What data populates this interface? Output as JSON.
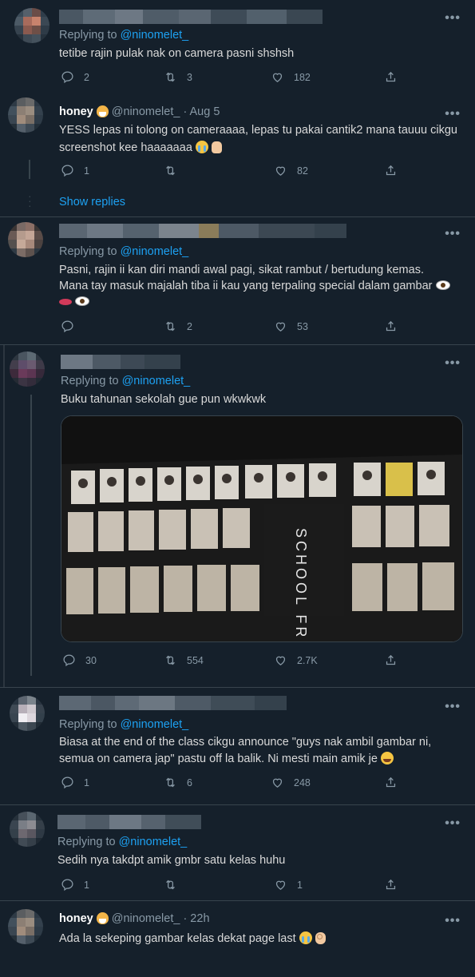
{
  "colors": {
    "background": "#15202b",
    "divider": "#38444d",
    "link": "#1da1f2",
    "muted": "#8899a6",
    "text": "#d9d9d9"
  },
  "replying_label": "Replying to",
  "more_label": "•••",
  "icons": {
    "reply": "reply-icon",
    "retweet": "retweet-icon",
    "like": "heart-icon",
    "share": "share-icon",
    "more": "more-icon"
  },
  "tweets": [
    {
      "mention": "@ninomelet_",
      "text_lines": [
        "tetibe rajin pulak nak on camera pasni shshsh"
      ],
      "replies": "2",
      "retweets": "3",
      "likes": "182"
    },
    {
      "name": "honey",
      "handle": "@ninomelet_",
      "time": "· Aug 5",
      "text_lines": [
        "YESS lepas ni tolong on cameraaaa, lepas tu pakai cantik2 mana tauuu cikgu",
        "screenshot kee haaaaaaa"
      ],
      "replies": "1",
      "retweets": "",
      "likes": "82",
      "show_replies": "Show replies"
    },
    {
      "mention": "@ninomelet_",
      "text_lines": [
        "Pasni, rajin ii kan diri mandi awal pagi, sikat rambut / bertudung kemas.",
        "Mana tay masuk majalah tiba ii kau yang terpaling special dalam gambar",
        ""
      ],
      "replies": "",
      "retweets": "2",
      "likes": "53"
    },
    {
      "mention": "@ninomelet_",
      "text_lines": [
        "Buku tahunan sekolah gue pun wkwkwk"
      ],
      "image_text": "SCHOOL FR",
      "replies": "30",
      "retweets": "554",
      "likes": "2.7K"
    },
    {
      "mention": "@ninomelet_",
      "text_lines": [
        "Biasa at the end of the class cikgu announce \"guys nak ambil gambar ni,",
        "semua on camera jap\" pastu off la balik. Ni mesti main amik je "
      ],
      "replies": "1",
      "retweets": "6",
      "likes": "248"
    },
    {
      "mention": "@ninomelet_",
      "text_lines": [
        "Sedih nya takdpt amik gmbr satu kelas huhu"
      ],
      "replies": "1",
      "retweets": "",
      "likes": "1"
    },
    {
      "name": "honey",
      "handle": "@ninomelet_",
      "time": "· 22h",
      "text_lines": [
        "Ada la sekeping gambar kelas dekat page last "
      ]
    }
  ]
}
